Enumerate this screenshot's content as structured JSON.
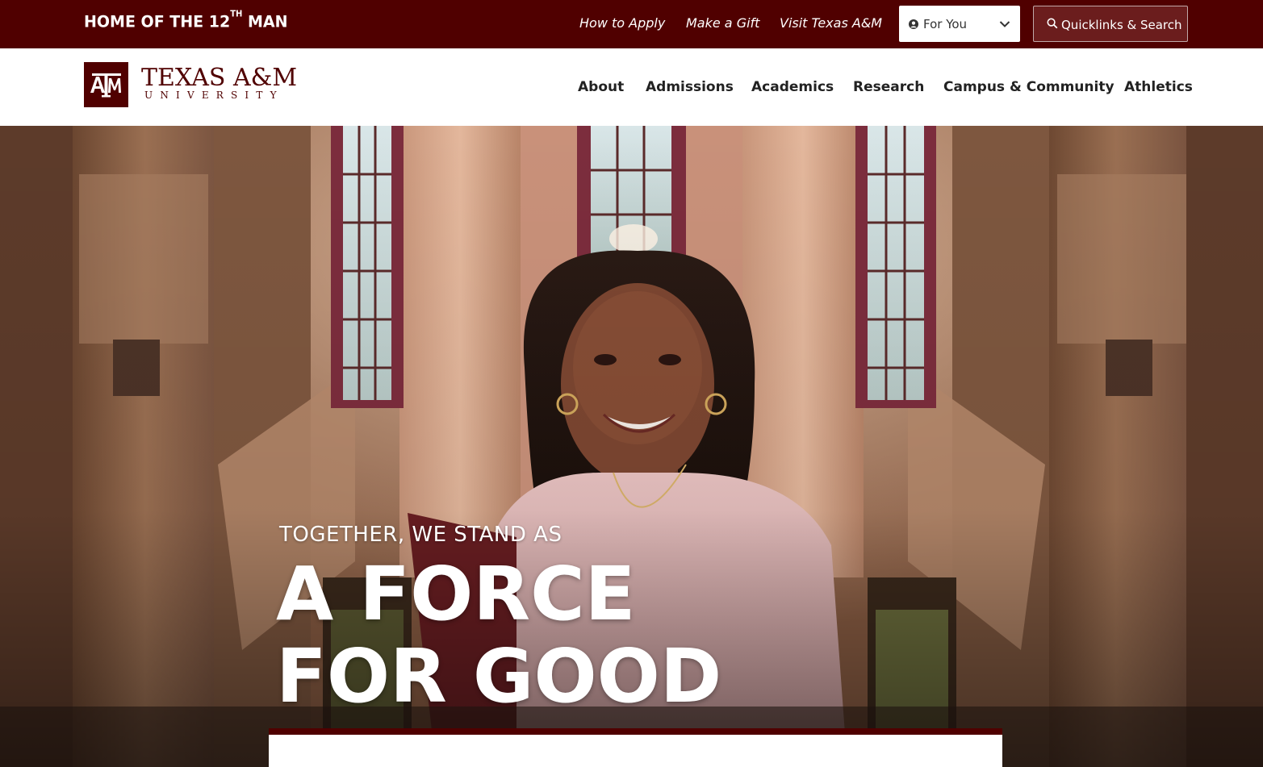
{
  "topbar": {
    "tagline_main": "HOME OF THE 12",
    "tagline_sup": "TH",
    "tagline_end": " MAN",
    "links": [
      "How to Apply",
      "Make a Gift",
      "Visit Texas A&M"
    ],
    "for_you_label": "For You",
    "quicklinks_label": "Quicklinks & Search"
  },
  "header": {
    "logo_monogram": "ATM",
    "logo_word": "TEXAS A&M",
    "logo_sub": "UNIVERSITY",
    "nav": [
      "About",
      "Admissions",
      "Academics",
      "Research",
      "Campus & Community",
      "Athletics"
    ]
  },
  "hero": {
    "kicker": "TOGETHER, WE STAND AS",
    "headline_line1": "A FORCE",
    "headline_line2": "FOR GOOD"
  },
  "colors": {
    "maroon": "#500000",
    "white": "#ffffff"
  },
  "icons": [
    "person-circle-icon",
    "chevron-down-icon",
    "search-icon"
  ]
}
